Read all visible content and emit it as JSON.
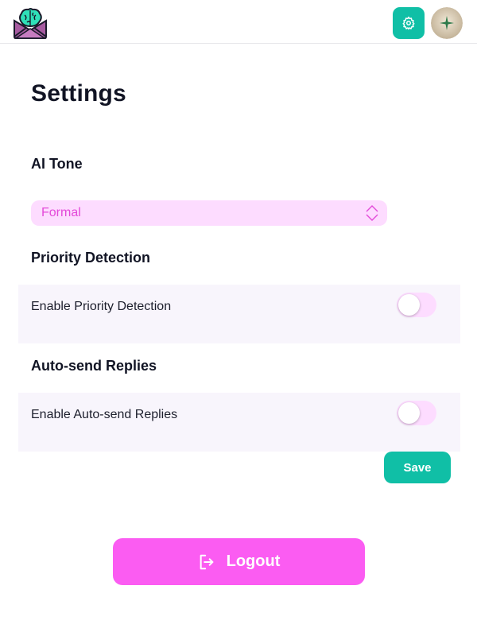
{
  "header": {
    "logo_icon": "brain-envelope-logo",
    "settings_icon": "gear-icon",
    "avatar_icon": "user-avatar"
  },
  "page": {
    "title": "Settings"
  },
  "ai_tone": {
    "title": "AI Tone",
    "selected": "Formal"
  },
  "priority_detection": {
    "title": "Priority Detection",
    "option_label": "Enable Priority Detection",
    "enabled": false
  },
  "auto_send": {
    "title": "Auto-send Replies",
    "option_label": "Enable Auto-send Replies",
    "enabled": false
  },
  "actions": {
    "save_label": "Save",
    "logout_label": "Logout",
    "logout_icon": "logout-icon"
  },
  "colors": {
    "accent_teal": "#10bfa6",
    "accent_pink": "#fb5cf2",
    "soft_pink": "#fddcff"
  }
}
